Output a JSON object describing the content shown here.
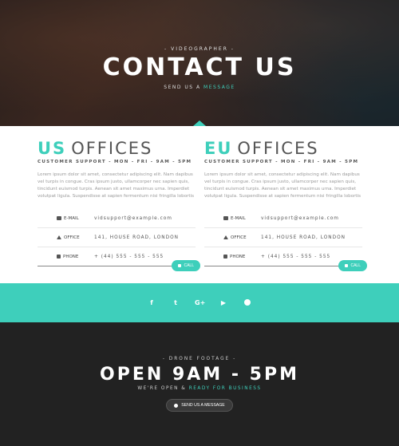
{
  "hero": {
    "kicker": "- VIDEOGRAPHER -",
    "title": "CONTACT US",
    "sub_prefix": "SEND US A",
    "sub_accent": "MESSAGE"
  },
  "offices": [
    {
      "code": "US",
      "title_rest": "OFFICES",
      "support": "CUSTOMER SUPPORT - MON - FRI - 9AM - 5PM",
      "description": "Lorem ipsum dolor sit amet, consectetur adipiscing elit. Nam dapibus vel turpis in congue. Cras ipsum justo, ullamcorper nec sapien quis, tincidunt euismod turpis. Aenean sit amet maximus urna. Imperdiet volutpat ligula. Suspendisse at sapien fermentum nisi fringilla lobortis",
      "rows": [
        {
          "label": "E-MAIL",
          "value": "vidsupport@example.com",
          "icon": "envelope-icon"
        },
        {
          "label": "OFFICE",
          "value": "141, HOUSE ROAD, LONDON",
          "icon": "home-icon"
        },
        {
          "label": "PHONE",
          "value": "+ (44) 555 - 555 - 555",
          "icon": "phone-icon"
        }
      ],
      "call_label": "CALL"
    },
    {
      "code": "EU",
      "title_rest": "OFFICES",
      "support": "CUSTOMER SUPPORT - MON - FRI - 9AM - 5PM",
      "description": "Lorem ipsum dolor sit amet, consectetur adipiscing elit. Nam dapibus vel turpis in congue. Cras ipsum justo, ullamcorper nec sapien quis, tincidunt euismod turpis. Aenean sit amet maximus urna. Imperdiet volutpat ligula. Suspendisse at sapien fermentum nisi fringilla lobortis",
      "rows": [
        {
          "label": "E-MAIL",
          "value": "vidsupport@example.com",
          "icon": "envelope-icon"
        },
        {
          "label": "OFFICE",
          "value": "141, HOUSE ROAD, LONDON",
          "icon": "home-icon"
        },
        {
          "label": "PHONE",
          "value": "+ (44) 555 - 555 - 555",
          "icon": "phone-icon"
        }
      ],
      "call_label": "CALL"
    }
  ],
  "social": {
    "items": [
      {
        "name": "facebook-icon",
        "glyph": "f"
      },
      {
        "name": "twitter-icon",
        "glyph": "t"
      },
      {
        "name": "google-plus-icon",
        "glyph": "G+"
      },
      {
        "name": "youtube-icon",
        "glyph": "▶"
      },
      {
        "name": "telegram-icon",
        "glyph": ""
      }
    ]
  },
  "footer": {
    "kicker": "- DRONE FOOTAGE -",
    "title": "OPEN 9AM - 5PM",
    "sub_prefix": "WE'RE OPEN &",
    "sub_accent": "READY FOR BUSINESS",
    "button_label": "SEND US A MESSAGE"
  },
  "colors": {
    "accent": "#3ecfbb",
    "footer_bg": "#222222"
  }
}
